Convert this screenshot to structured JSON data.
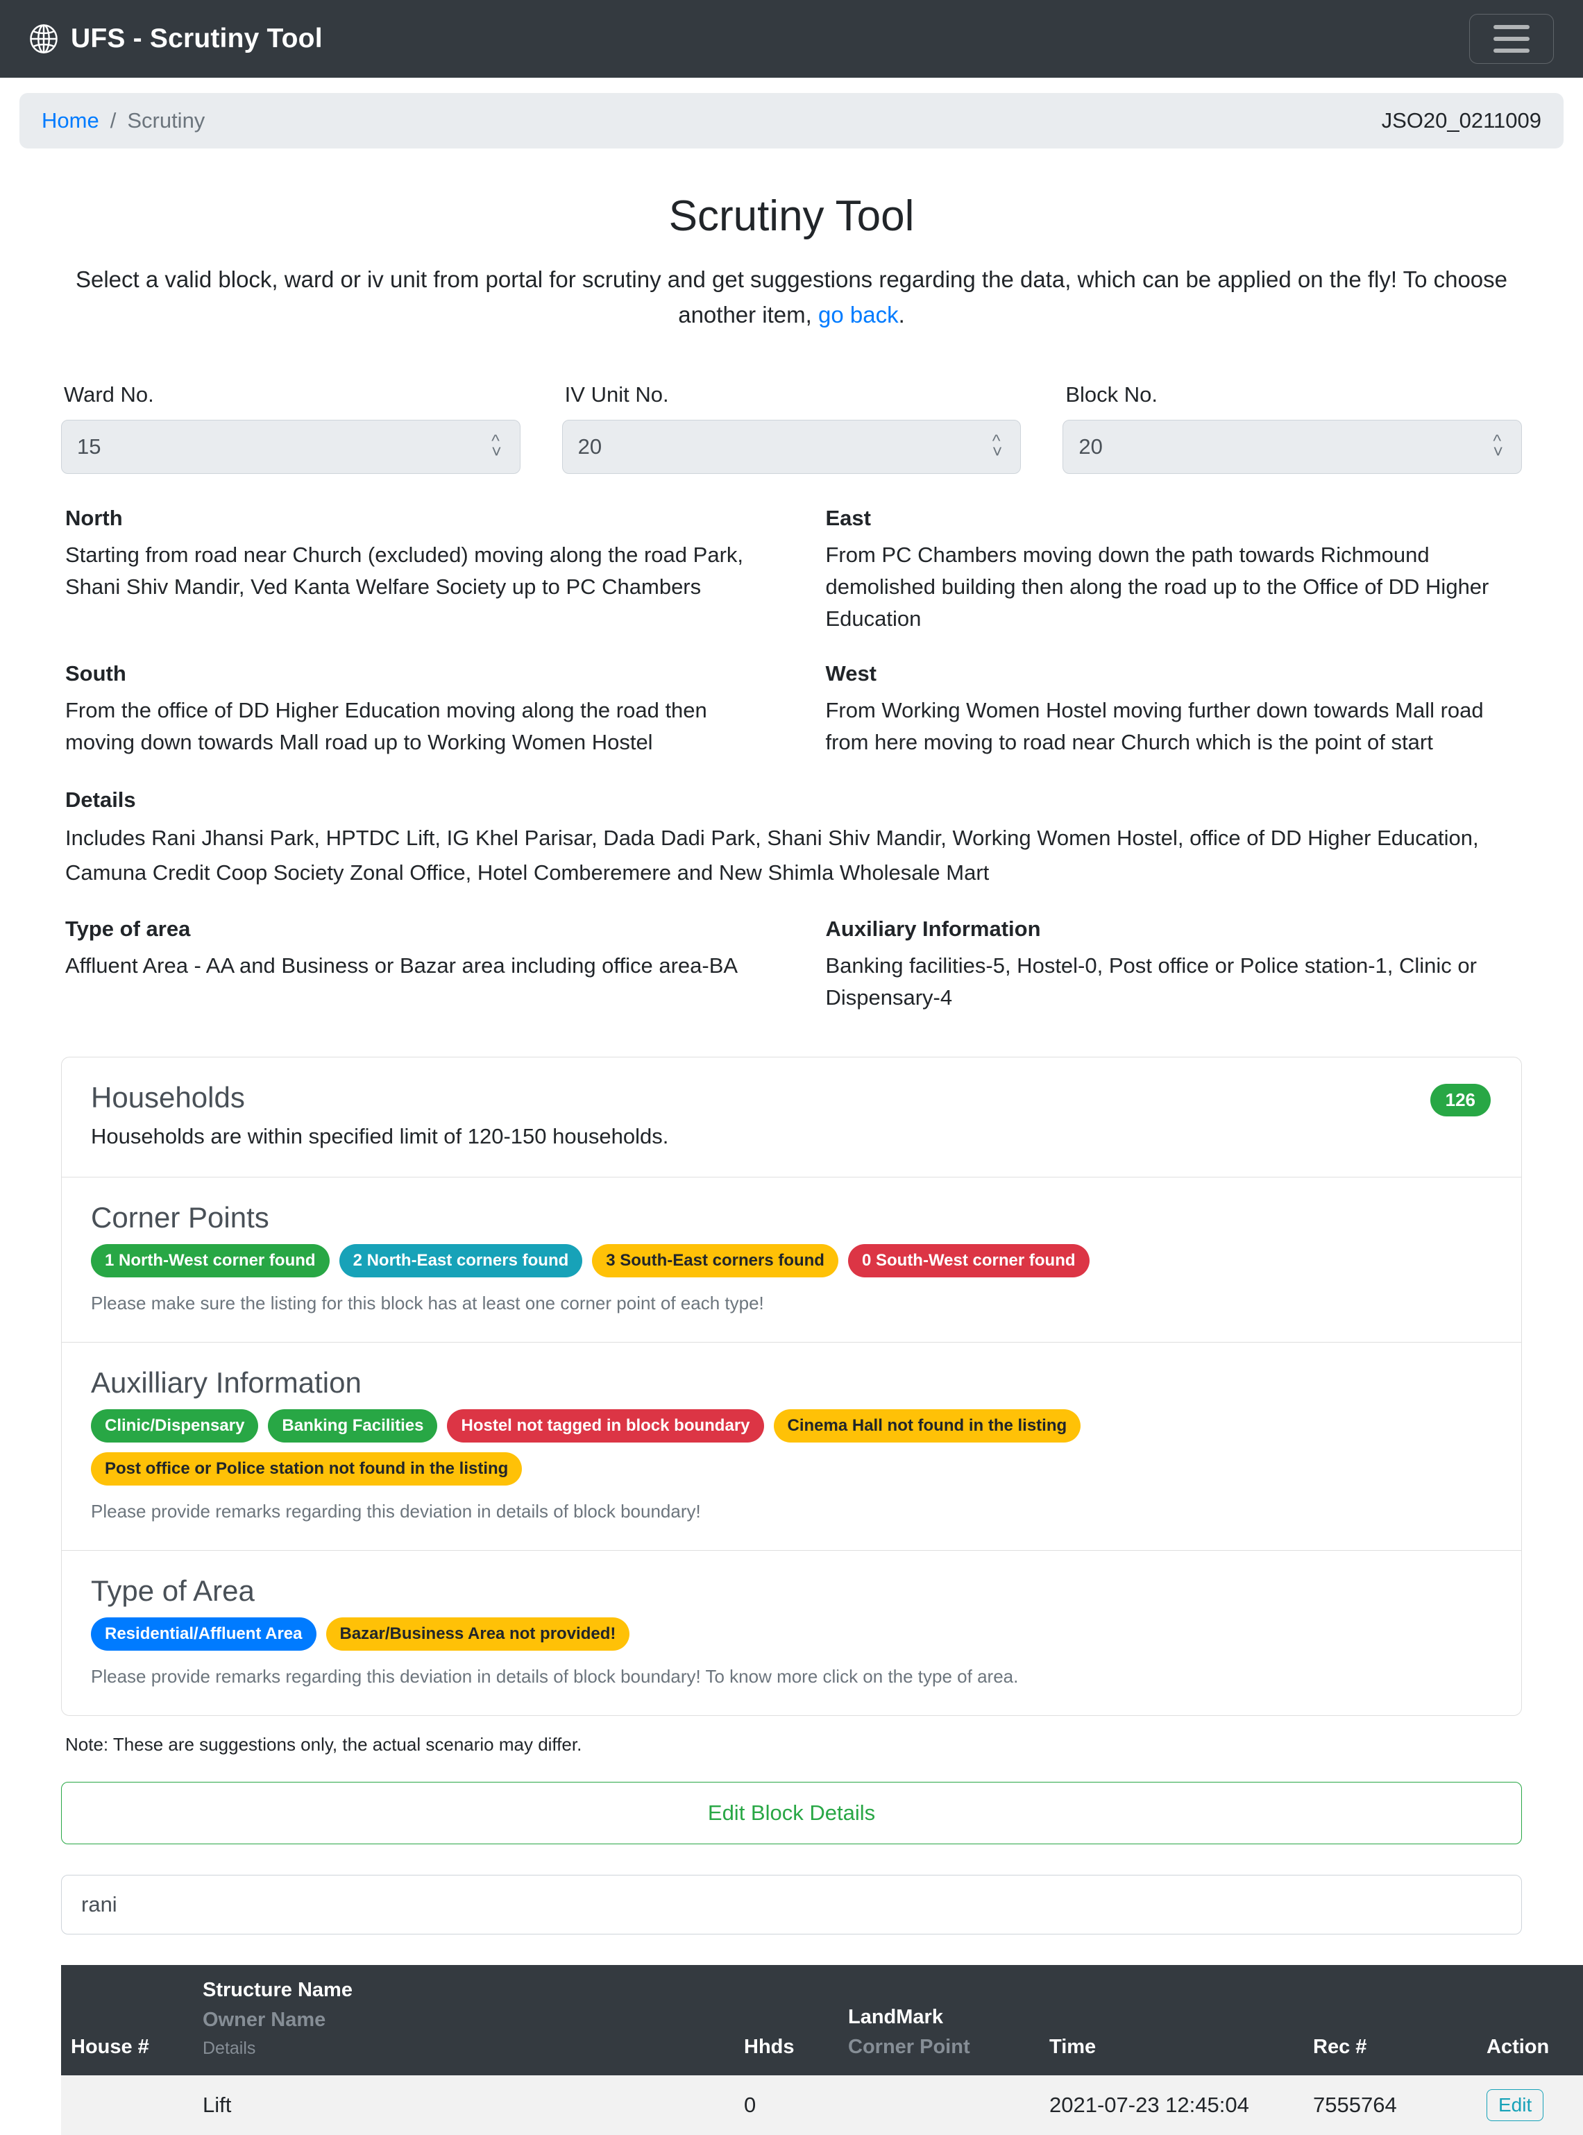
{
  "navbar": {
    "brand": "UFS - Scrutiny Tool",
    "logo_icon": "globe-icon",
    "toggler_icon": "hamburger-menu-icon"
  },
  "breadcrumb": {
    "home": "Home",
    "separator": "/",
    "current": "Scrutiny",
    "job_id": "JSO20_0211009"
  },
  "page": {
    "title": "Scrutiny Tool",
    "lead_part1": "Select a valid block, ward or iv unit from portal for scrutiny and get suggestions regarding the data, which can be applied on the fly! To choose another item, ",
    "lead_link": "go back",
    "lead_part2": "."
  },
  "selectors": [
    {
      "label": "Ward No.",
      "value": "15"
    },
    {
      "label": "IV Unit No.",
      "value": "20"
    },
    {
      "label": "Block No.",
      "value": "20"
    }
  ],
  "boundaries": {
    "north_label": "North",
    "north_text": "Starting from road near Church (excluded) moving along the road Park, Shani Shiv Mandir, Ved Kanta Welfare Society up to PC Chambers",
    "east_label": "East",
    "east_text": "From PC Chambers moving down the path towards Richmound demolished building then along the road up to the Office of DD Higher Education",
    "south_label": "South",
    "south_text": "From the office of DD Higher Education moving along the road then moving down towards Mall road up to Working Women Hostel",
    "west_label": "West",
    "west_text": "From Working Women Hostel moving further down towards Mall road from here moving to road near Church which is the point of start",
    "details_label": "Details",
    "details_text": "Includes Rani Jhansi Park, HPTDC Lift, IG Khel Parisar, Dada Dadi Park, Shani Shiv Mandir, Working Women Hostel, office of DD Higher Education, Camuna Credit Coop Society Zonal Office, Hotel Comberemere and New Shimla Wholesale Mart",
    "type_of_area_label": "Type of area",
    "type_of_area_text": "Affluent Area - AA and Business or Bazar area including office area-BA",
    "auxiliary_label": "Auxiliary Information",
    "auxiliary_text": "Banking facilities-5, Hostel-0, Post office or Police station-1, Clinic or Dispensary-4"
  },
  "suggestions": {
    "households": {
      "title": "Households",
      "description": "Households are within specified limit of 120-150 households.",
      "count": "126",
      "count_color": "#28a745"
    },
    "corner_points": {
      "title": "Corner Points",
      "badges": [
        {
          "text": "1 North-West corner found",
          "variant": "b-success",
          "color": "#28a745"
        },
        {
          "text": "2 North-East corners found",
          "variant": "b-info",
          "color": "#17a2b8"
        },
        {
          "text": "3 South-East corners found",
          "variant": "b-warning",
          "color": "#ffc107"
        },
        {
          "text": "0 South-West corner found",
          "variant": "b-danger",
          "color": "#dc3545"
        }
      ],
      "note": "Please make sure the listing for this block has at least one corner point of each type!"
    },
    "auxilliary": {
      "title": "Auxilliary Information",
      "badges": [
        {
          "text": "Clinic/Dispensary",
          "variant": "b-success",
          "color": "#28a745"
        },
        {
          "text": "Banking Facilities",
          "variant": "b-success",
          "color": "#28a745"
        },
        {
          "text": "Hostel not tagged in block boundary",
          "variant": "b-danger",
          "color": "#dc3545"
        },
        {
          "text": "Cinema Hall not found in the listing",
          "variant": "b-warning",
          "color": "#ffc107"
        },
        {
          "text": "Post office or Police station not found in the listing",
          "variant": "b-warning",
          "color": "#ffc107"
        }
      ],
      "note": "Please provide remarks regarding this deviation in details of block boundary!"
    },
    "type_of_area": {
      "title": "Type of Area",
      "badges": [
        {
          "text": "Residential/Affluent Area",
          "variant": "b-primary",
          "color": "#007bff"
        },
        {
          "text": "Bazar/Business Area not provided!",
          "variant": "b-warning",
          "color": "#ffc107"
        }
      ],
      "note": "Please provide remarks regarding this deviation in details of block boundary! To know more click on the type of area."
    },
    "footer_note": "Note: These are suggestions only, the actual scenario may differ."
  },
  "actions": {
    "edit_block_details": "Edit Block Details"
  },
  "search": {
    "value": "rani",
    "placeholder": ""
  },
  "table": {
    "headers": {
      "house": "House #",
      "structure_name": "Structure Name",
      "owner_name": "Owner Name",
      "details": "Details",
      "hhds": "Hhds",
      "landmark": "LandMark",
      "corner_point": "Corner Point",
      "time": "Time",
      "rec": "Rec #",
      "action": "Action"
    },
    "rows": [
      {
        "house": "",
        "structure_name": "Lift",
        "owner_name": "",
        "details": "",
        "hhds": "0",
        "landmark": "",
        "corner_point": "",
        "time": "2021-07-23 12:45:04",
        "rec": "7555764",
        "action": "Edit"
      }
    ]
  }
}
